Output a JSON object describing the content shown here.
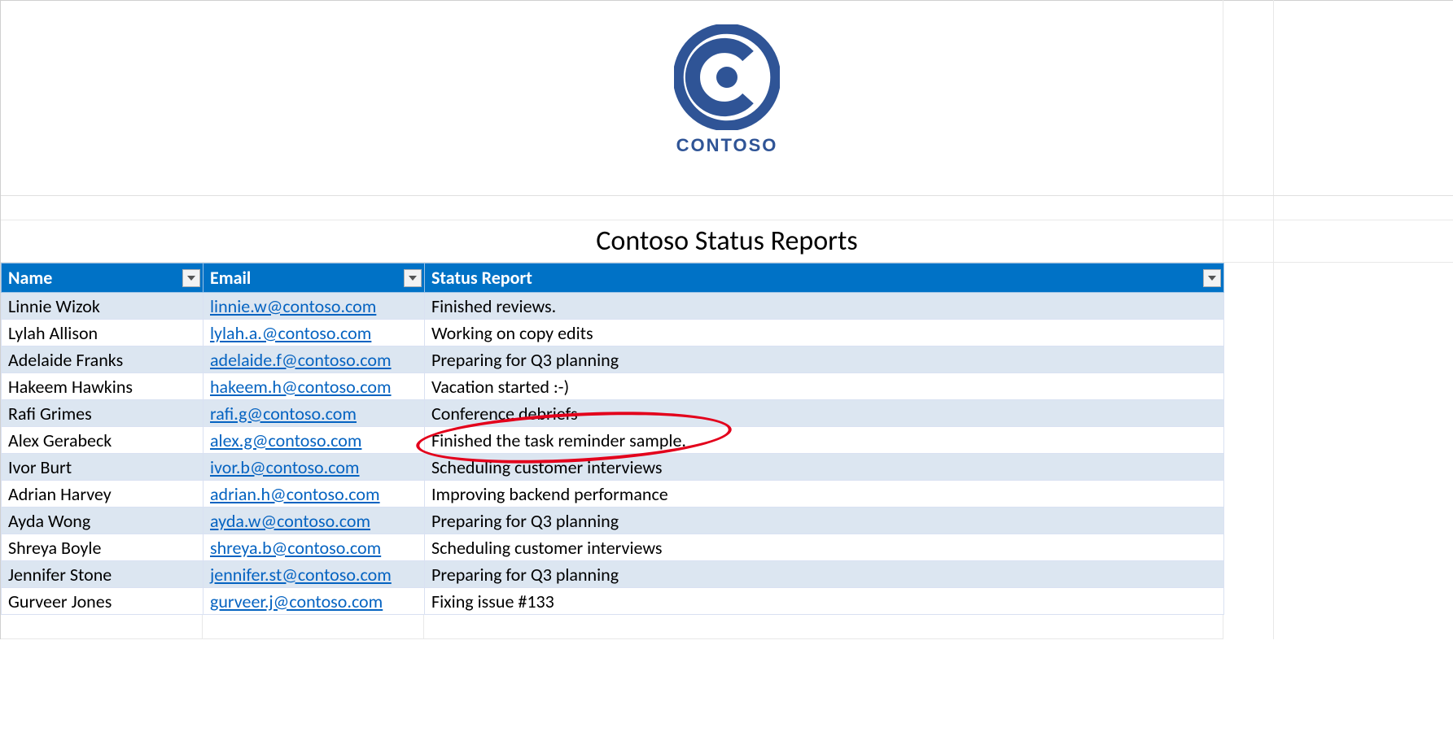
{
  "logo": {
    "brand": "CONTOSO"
  },
  "title": "Contoso Status Reports",
  "headers": {
    "name": "Name",
    "email": "Email",
    "status": "Status Report"
  },
  "rows": [
    {
      "name": "Linnie Wizok",
      "email": "linnie.w@contoso.com",
      "status": "Finished reviews."
    },
    {
      "name": "Lylah Allison",
      "email": "lylah.a.@contoso.com",
      "status": "Working on copy edits"
    },
    {
      "name": "Adelaide Franks",
      "email": "adelaide.f@contoso.com",
      "status": "Preparing for Q3 planning"
    },
    {
      "name": "Hakeem Hawkins",
      "email": "hakeem.h@contoso.com",
      "status": "Vacation started :-)"
    },
    {
      "name": "Rafi Grimes",
      "email": "rafi.g@contoso.com",
      "status": "Conference debriefs"
    },
    {
      "name": "Alex Gerabeck",
      "email": "alex.g@contoso.com",
      "status": "Finished the task reminder sample."
    },
    {
      "name": "Ivor Burt",
      "email": "ivor.b@contoso.com",
      "status": "Scheduling customer interviews"
    },
    {
      "name": "Adrian Harvey",
      "email": "adrian.h@contoso.com",
      "status": "Improving backend performance"
    },
    {
      "name": "Ayda Wong",
      "email": "ayda.w@contoso.com",
      "status": "Preparing for Q3 planning"
    },
    {
      "name": "Shreya Boyle",
      "email": "shreya.b@contoso.com",
      "status": "Scheduling customer interviews"
    },
    {
      "name": "Jennifer Stone",
      "email": "jennifer.st@contoso.com",
      "status": "Preparing for Q3 planning"
    },
    {
      "name": "Gurveer Jones",
      "email": "gurveer.j@contoso.com",
      "status": "Fixing issue #133"
    }
  ],
  "annotation": {
    "highlighted_row_index": 5
  }
}
